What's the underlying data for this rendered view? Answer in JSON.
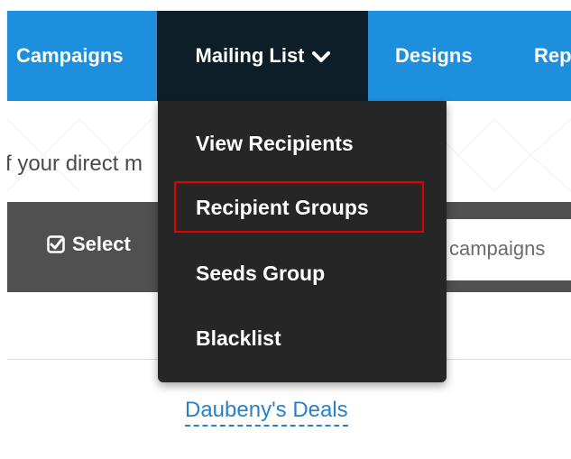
{
  "nav": {
    "campaigns": "Campaigns",
    "mailing_list": "Mailing List",
    "designs": "Designs",
    "reports": "Rep"
  },
  "hero": {
    "text": "f your direct m"
  },
  "toolbar": {
    "select_label": "Select",
    "search_placeholder": "campaigns"
  },
  "dropdown": {
    "items": [
      {
        "label": "View Recipients"
      },
      {
        "label": "Recipient Groups"
      },
      {
        "label": "Seeds Group"
      },
      {
        "label": "Blacklist"
      }
    ],
    "highlighted_item": "Recipient Groups"
  },
  "list": {
    "link": "Daubeny's Deals"
  },
  "colors": {
    "nav_bg": "#1e8fdd",
    "nav_active_bg": "#0e1e29",
    "toolbar_bg": "#505050",
    "dropdown_bg": "#262626",
    "highlight": "#e60000",
    "link": "#2a7fc9"
  }
}
